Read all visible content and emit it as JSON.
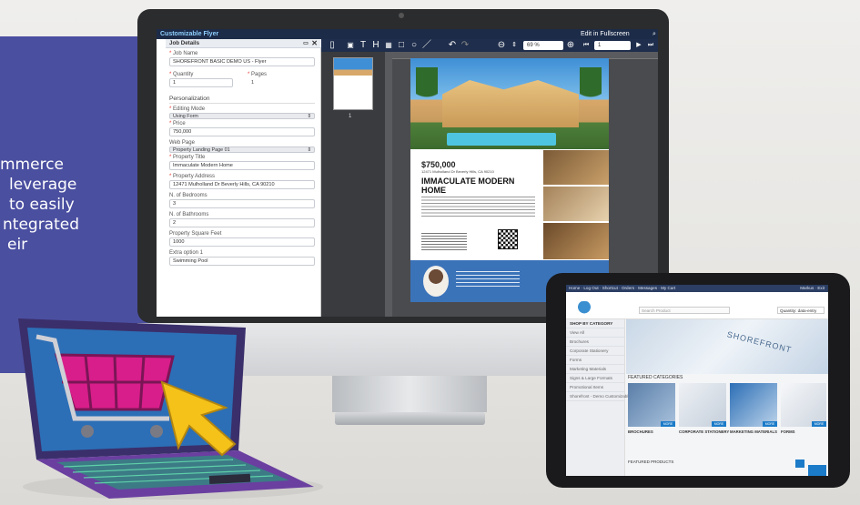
{
  "promo": {
    "lines": [
      "mmerce",
      "leverage",
      "to easily",
      "ntegrated",
      "eir"
    ]
  },
  "editor": {
    "app_title": "Customizable Flyer",
    "fullscreen_label": "Edit in Fullscreen",
    "panel_title": "Job Details",
    "job_name_label": "Job Name",
    "job_name_value": "SHOREFRONT BASIC DEMO US - Flyer",
    "quantity_label": "Quantity",
    "quantity_value": "1",
    "pages_label": "Pages",
    "pages_value": "1",
    "personalization_title": "Personalization",
    "editing_mode_label": "Editing Mode",
    "editing_mode_value": "Using Form",
    "price_label": "Price",
    "price_value": "750,000",
    "web_page_label": "Web Page",
    "web_page_value": "Property Landing Page 01",
    "property_title_label": "Property Title",
    "property_title_value": "Immaculate Modern Home",
    "property_address_label": "Property Address",
    "property_address_value": "12471 Mulholland Dr Beverly Hills, CA 90210",
    "bedrooms_label": "N. of Bedrooms",
    "bedrooms_value": "3",
    "bathrooms_label": "N. of Bathrooms",
    "bathrooms_value": "2",
    "sqft_label": "Property Square Feet",
    "sqft_value": "1000",
    "extra_label": "Extra option 1",
    "extra_value": "Swimming Pool",
    "zoom_value": "69 %",
    "page_value": "1",
    "thumb_number": "1"
  },
  "flyer": {
    "price": "$750,000",
    "address": "12471 Mulholland Dr Beverly Hills, CA 90210",
    "headline": "IMMACULATE MODERN HOME"
  },
  "tablet": {
    "topbar_text": "Home · Log Out · Shortcut · Orders · Messages · My Cart",
    "topbar_right": "Markus · Exit",
    "search_placeholder": "Search Product",
    "search2_value": "Quantity: data-entry",
    "side_header": "SHOP BY CATEGORY",
    "side_items": [
      "View All",
      "Brochures",
      "Corporate Stationery",
      "Forms",
      "Marketing Materials",
      "Signs & Large Formats",
      "Promotional Items",
      "Shorefront - Demo Customizable"
    ],
    "banner_watermark": "SHOREFRONT",
    "featured_title": "FEATURED CATEGORIES",
    "cards": [
      "BROCHURES",
      "CORPORATE STATIONERY",
      "MARKETING MATERIALS",
      "FORMS"
    ],
    "more_label": "MORE",
    "featured_products": "FEATURED PRODUCTS"
  },
  "colors": {
    "promo_bg": "#4b4fa0",
    "editor_bar": "#1c2b48",
    "tablet_accent": "#1b7bc8",
    "cursor_yellow": "#f5c21a",
    "cart_magenta": "#d81e8a"
  }
}
